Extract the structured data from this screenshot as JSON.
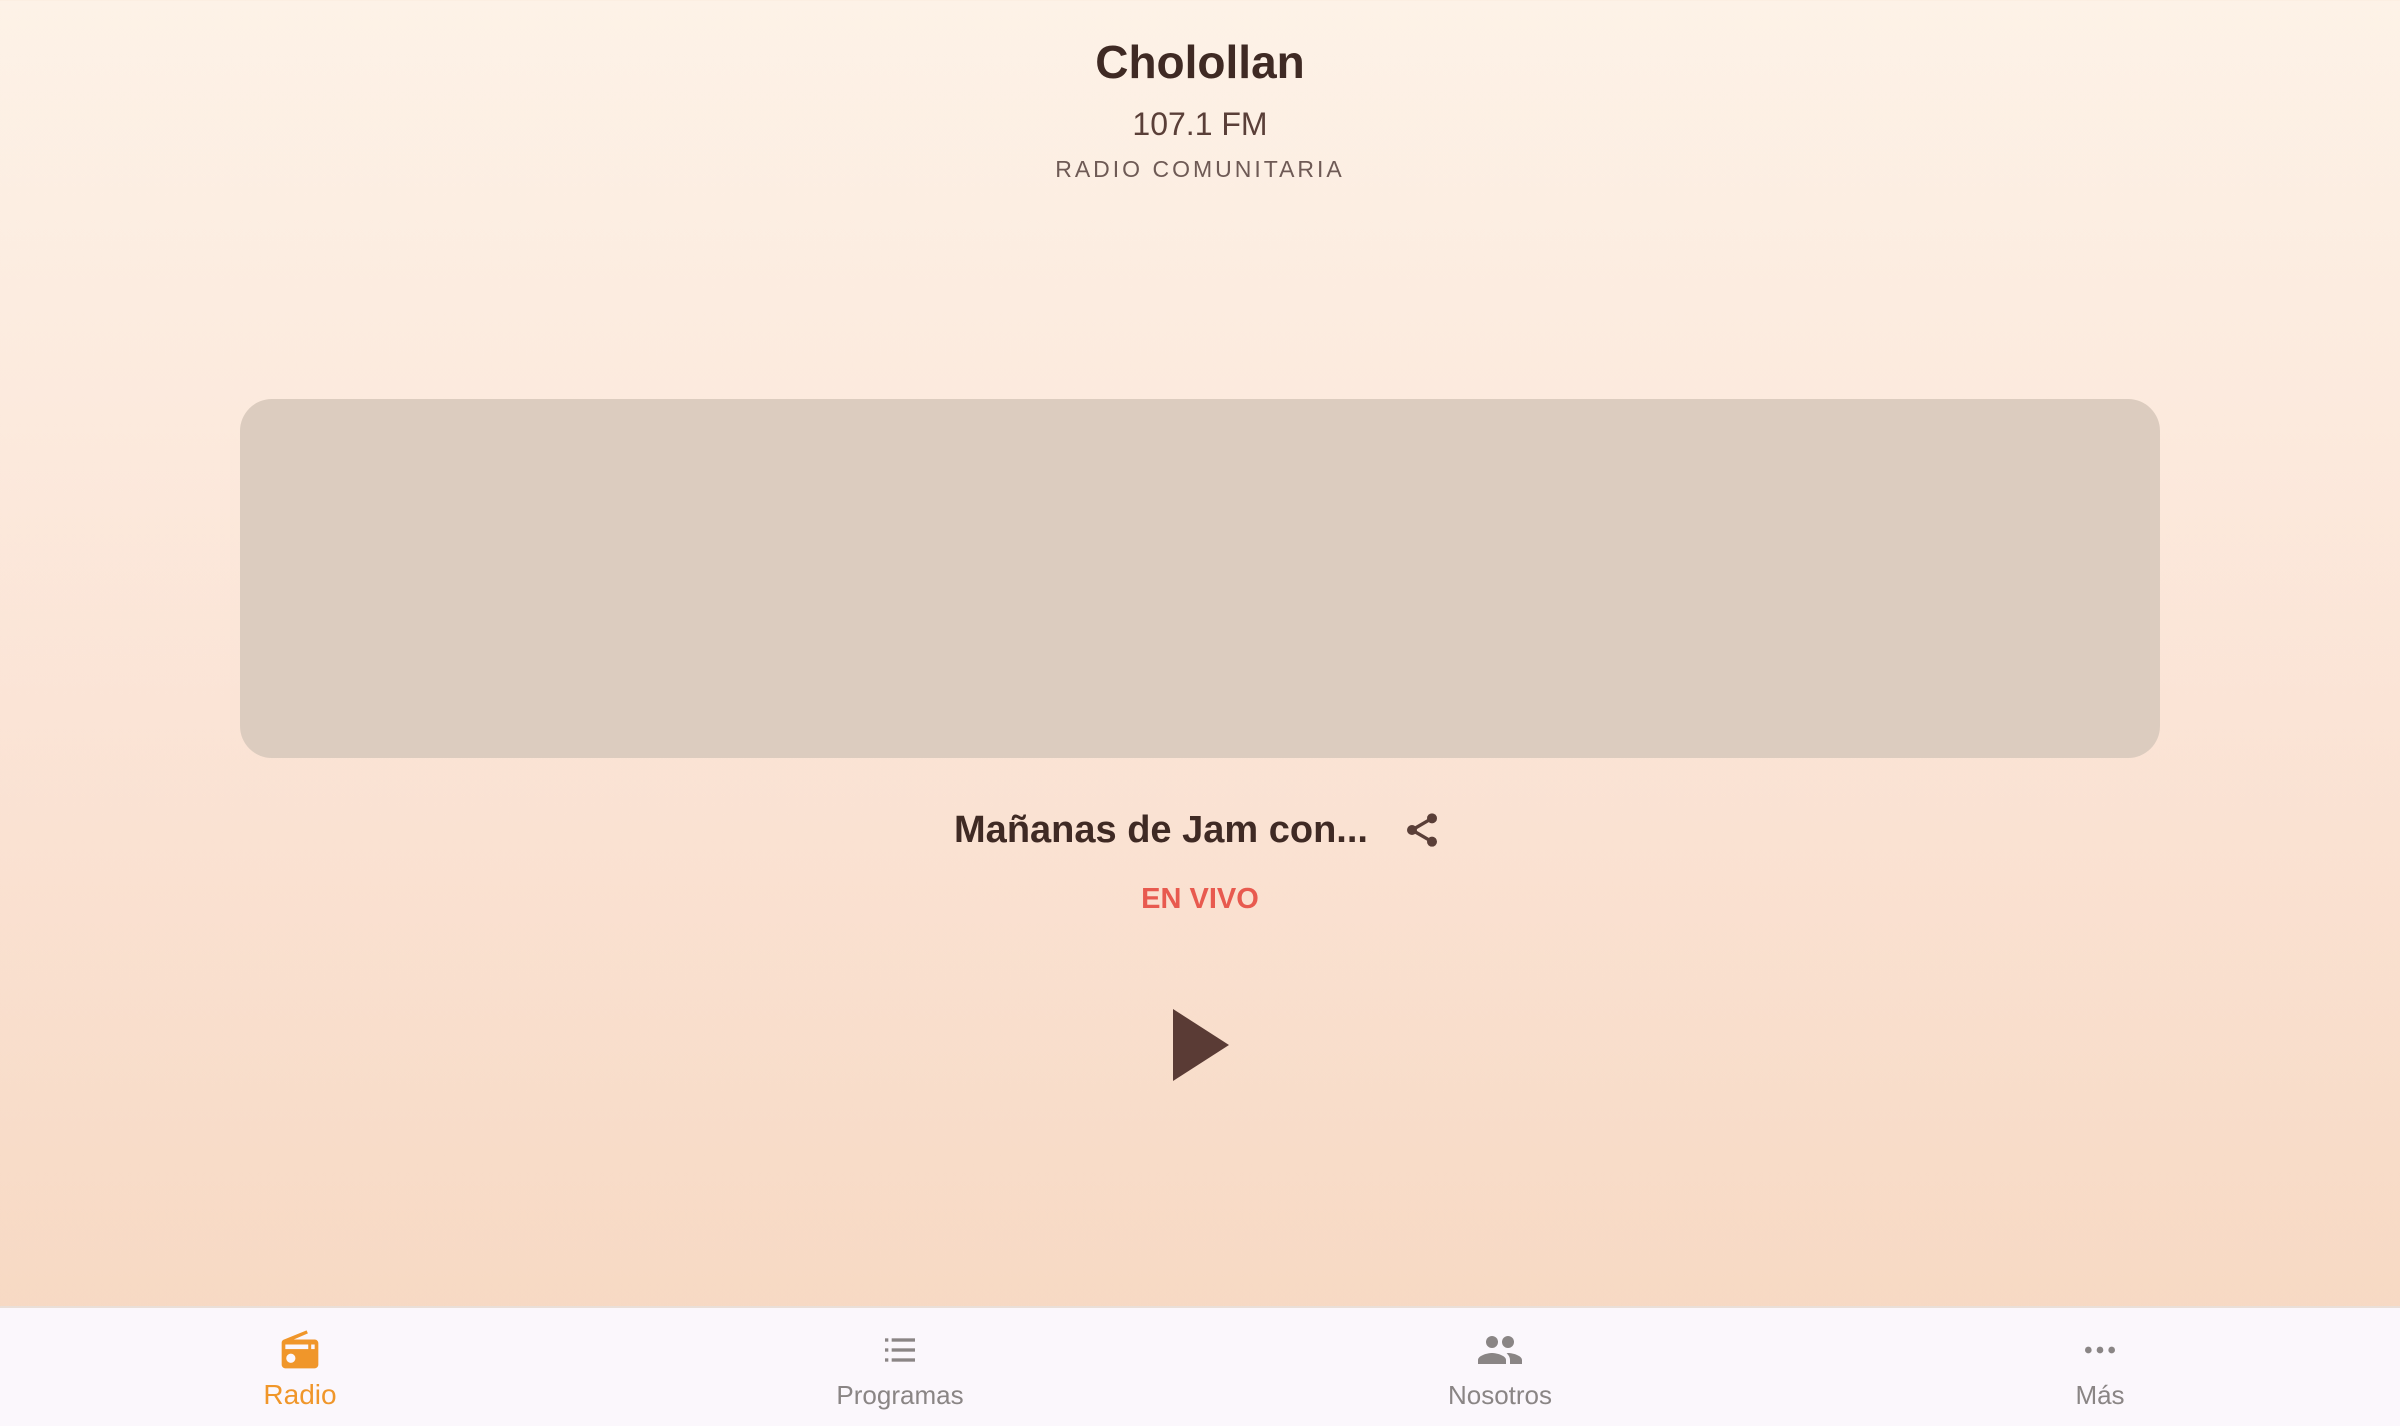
{
  "header": {
    "station_name": "Chololl​an",
    "frequency": "107.1 FM",
    "tagline": "RADIO COMUNITARIA"
  },
  "player": {
    "show_title": "Mañanas de Jam con...",
    "status": "EN VIVO",
    "share_icon": "share-icon",
    "play_icon": "play-icon"
  },
  "bottom_nav": {
    "items": [
      {
        "label": "Radio",
        "icon": "radio-icon",
        "active": true
      },
      {
        "label": "Programas",
        "icon": "list-icon",
        "active": false
      },
      {
        "label": "Nosotros",
        "icon": "people-icon",
        "active": false
      },
      {
        "label": "Más",
        "icon": "more-icon",
        "active": false
      }
    ]
  },
  "colors": {
    "accent": "#f0962a",
    "live": "#e85a4f",
    "text_primary": "#3f2a24",
    "artwork_placeholder": "#dcccbf",
    "nav_inactive": "#8a8585"
  }
}
